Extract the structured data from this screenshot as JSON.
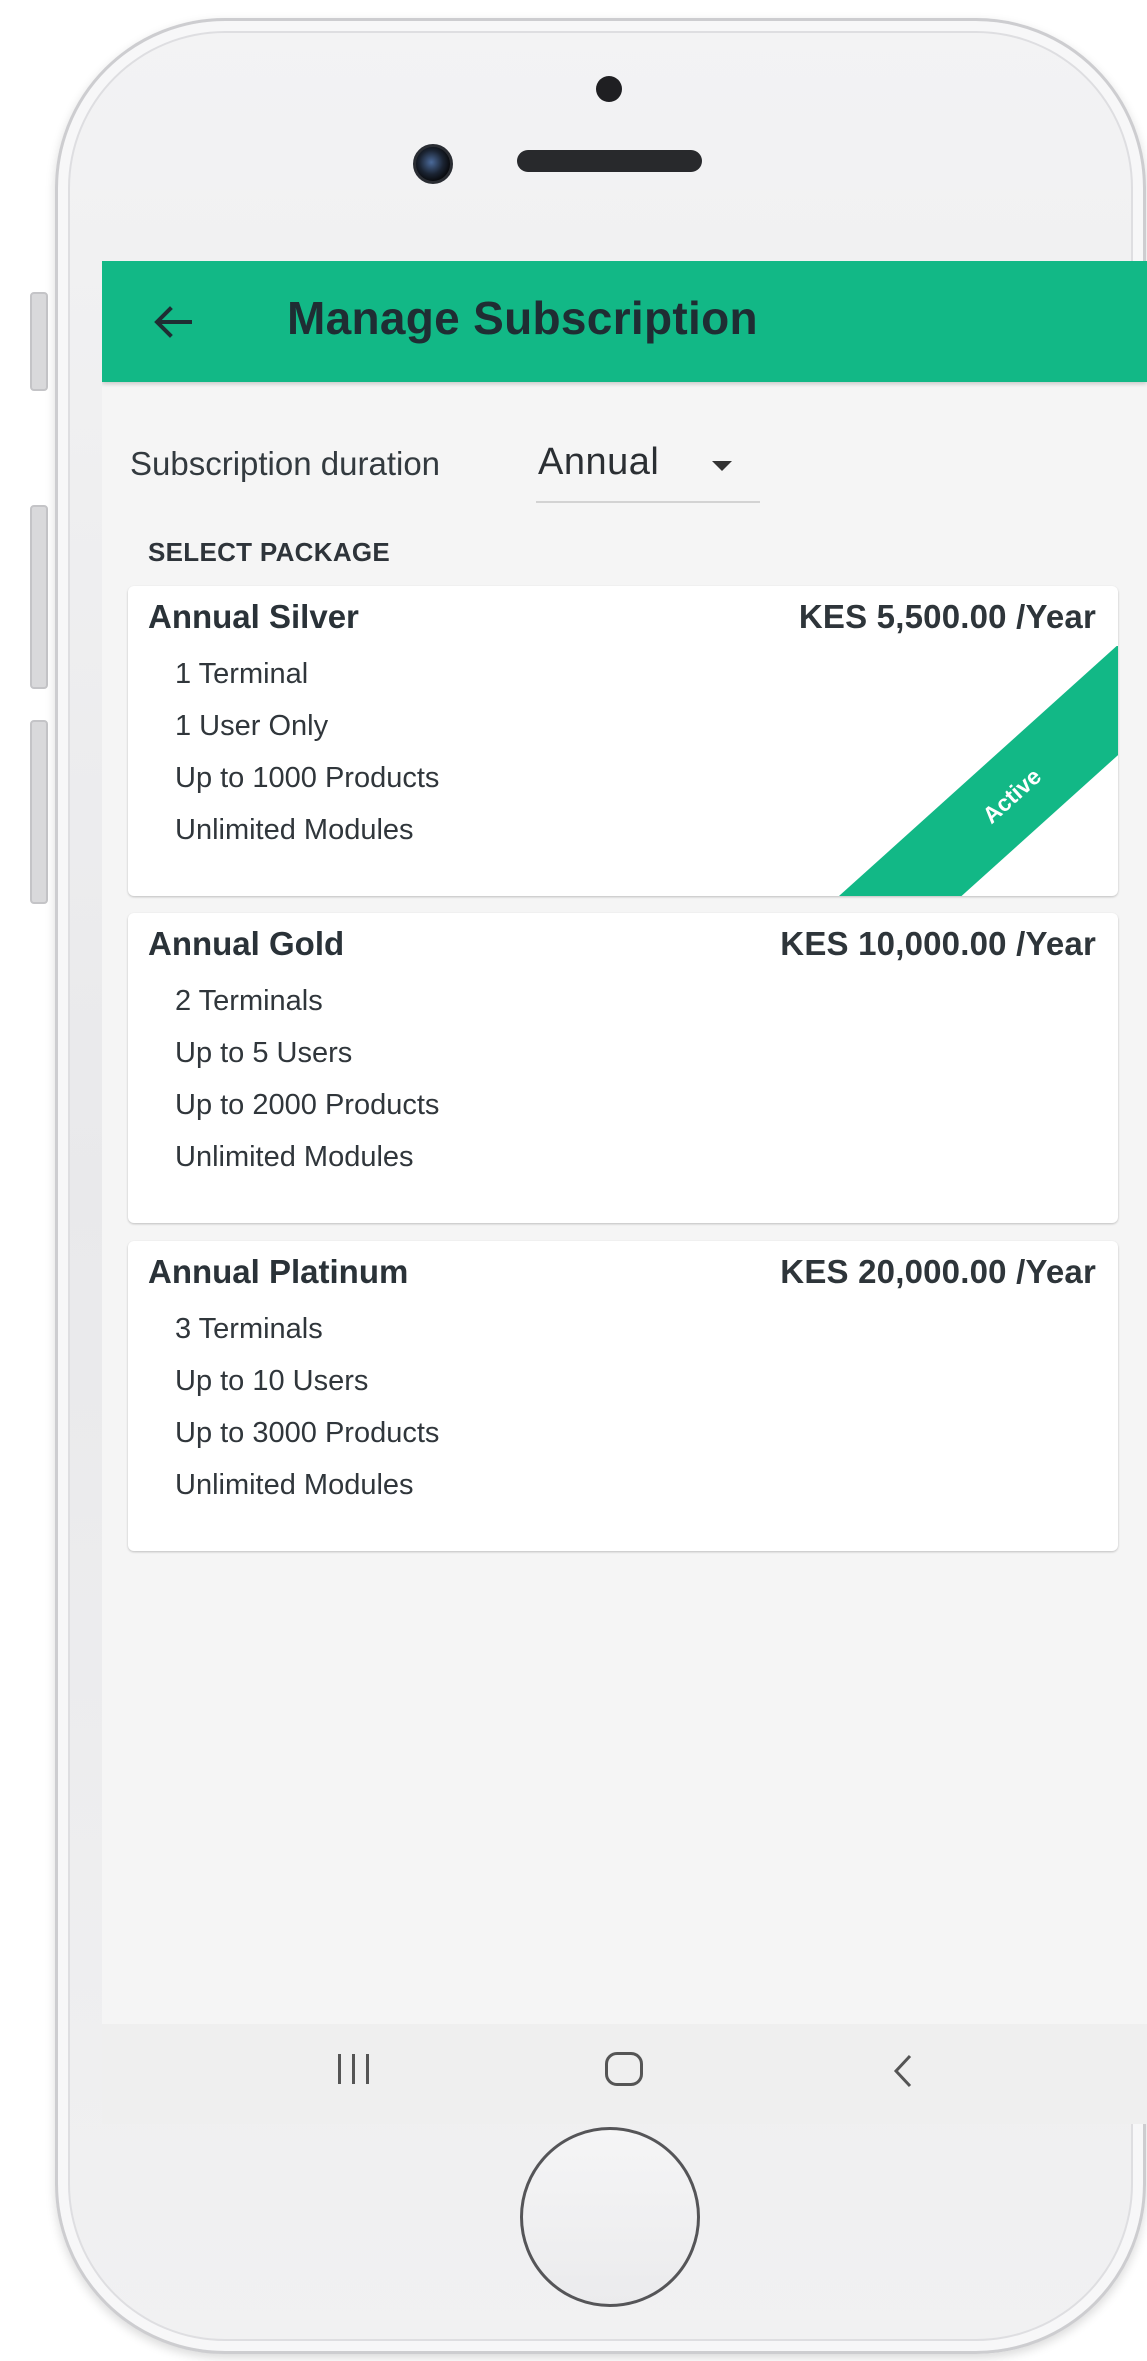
{
  "appbar": {
    "title": "Manage Subscription",
    "back_icon": "arrow-left-icon",
    "color": "#12b886"
  },
  "duration": {
    "label": "Subscription duration",
    "value": "Annual",
    "icon": "dropdown-arrow-icon"
  },
  "section_label": "SELECT PACKAGE",
  "packages": [
    {
      "name": "Annual Silver",
      "price": "KES 5,500.00 /Year",
      "features": [
        "1 Terminal",
        "1 User Only",
        "Up to 1000 Products",
        "Unlimited Modules"
      ],
      "active": true,
      "badge": "Active"
    },
    {
      "name": "Annual Gold",
      "price": "KES 10,000.00 /Year",
      "features": [
        "2 Terminals",
        "Up to 5 Users",
        "Up to 2000 Products",
        "Unlimited Modules"
      ],
      "active": false
    },
    {
      "name": "Annual Platinum",
      "price": "KES 20,000.00 /Year",
      "features": [
        "3 Terminals",
        "Up to 10 Users",
        "Up to 3000 Products",
        "Unlimited Modules"
      ],
      "active": false
    }
  ],
  "navbar": {
    "recents_icon": "recents-icon",
    "home_icon": "home-icon",
    "back_icon": "back-chevron-icon"
  }
}
